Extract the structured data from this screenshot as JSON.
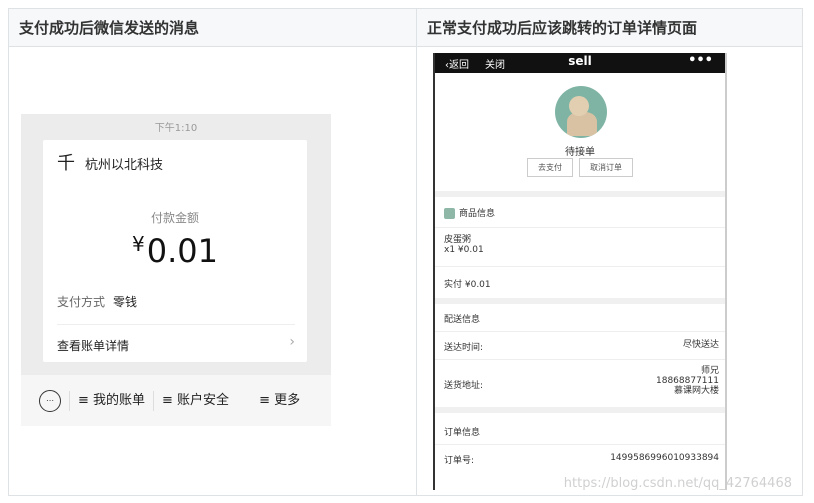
{
  "headers": {
    "left": "支付成功后微信发送的消息",
    "right": "正常支付成功后应该跳转的订单详情页面"
  },
  "wechat": {
    "time": "下午1:10",
    "merchant_glyph": "千",
    "merchant": "杭州以北科技",
    "amount_label": "付款金额",
    "currency": "¥",
    "amount": "0.01",
    "method_label": "支付方式",
    "method_value": "零钱",
    "detail_link": "查看账单详情",
    "chevron": "›",
    "menu": [
      "≡ 我的账单",
      "≡ 账户安全",
      "≡ 更多"
    ]
  },
  "order": {
    "back": "返回",
    "close": "关闭",
    "title": "sell",
    "dots": "•••",
    "status": "待接单",
    "buttons": [
      "去支付",
      "取消订单"
    ],
    "goods_header": "商品信息",
    "item_name": "皮蛋粥",
    "item_qty_price": "x1 ¥0.01",
    "paid": "实付 ¥0.01",
    "delivery_header": "配送信息",
    "time_label": "送达时间:",
    "time_value": "尽快送达",
    "address_label": "送货地址:",
    "address_name": "师兄",
    "address_phone": "18868877111",
    "address_place": "慕课网大楼",
    "order_header": "订单信息",
    "order_no_label": "订单号:",
    "order_no": "1499586996010933894"
  },
  "watermark": "https://blog.csdn.net/qq_42764468"
}
